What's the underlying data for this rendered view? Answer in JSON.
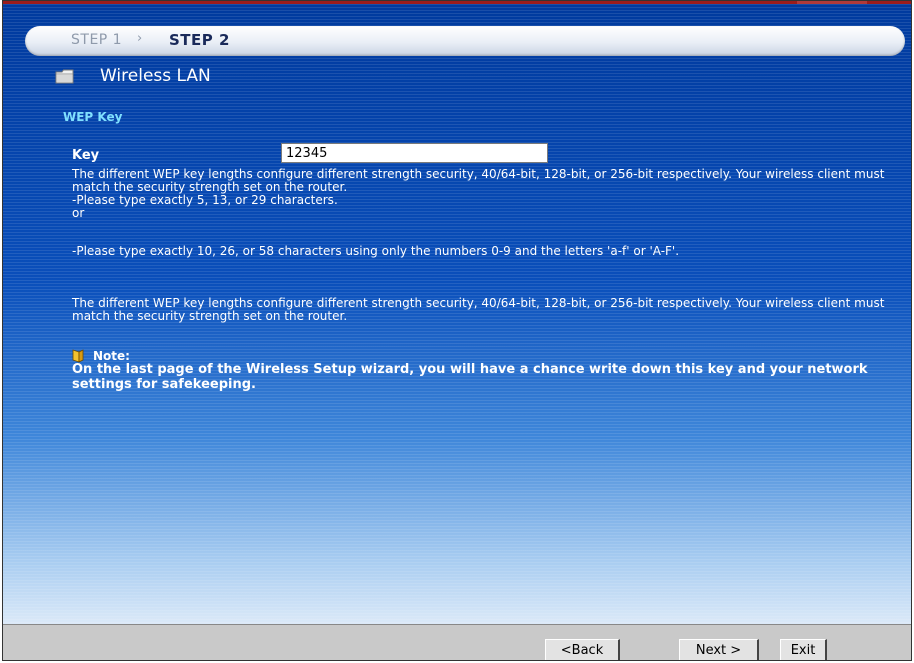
{
  "wizard": {
    "steps": [
      "STEP 1",
      "STEP 2"
    ],
    "step_separator": "›",
    "active_step": "STEP 2"
  },
  "section": {
    "title": "Wireless LAN",
    "icon": "folder-icon"
  },
  "wep": {
    "heading": "WEP Key",
    "key_label": "Key",
    "key_value": "12345",
    "para1": "The different WEP key lengths configure different strength security, 40/64-bit, 128-bit, or 256-bit respectively. Your wireless client must match the security strength set on the router.",
    "para2": "-Please type exactly 5, 13, or 29 characters.",
    "or": "or",
    "para3": "-Please type exactly 10, 26, or 58 characters using only the numbers 0-9 and the letters 'a-f' or 'A-F'.",
    "para4": "The different WEP key lengths configure different strength security, 40/64-bit, 128-bit, or 256-bit respectively. Your wireless client must match the security strength set on the router."
  },
  "note": {
    "icon": "note-icon",
    "label": "Note:",
    "text": "On the last page of the Wireless Setup wizard, you will have a chance write down this key and your network settings for safekeeping."
  },
  "buttons": {
    "back": "<Back",
    "next": "Next >",
    "exit": "Exit"
  },
  "colors": {
    "background_top": "#003a9e",
    "background_bottom": "#dbe9f8",
    "heading_accent": "#7fe0ff",
    "footer": "#c9c9c9"
  }
}
